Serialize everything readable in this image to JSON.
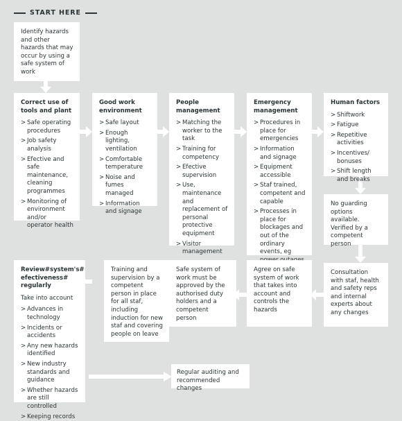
{
  "theme": {
    "background": "#dfe1e1",
    "box_fill": "#ffffff",
    "text": "#2b3436",
    "connector": "#ffffff"
  },
  "header": {
    "label": "START HERE"
  },
  "boxes": {
    "identify": {
      "title": "",
      "body": "Identify hazards and other hazards that may occur by using a safe system of work"
    },
    "tools": {
      "title": "Correct use of tools and plant",
      "items": [
        "Safe operating procedures",
        "Job safety analysis",
        "Efective and safe maintenance, cleaning programmes",
        "Monitoring of environment and/or operator health"
      ]
    },
    "environment": {
      "title": "Good work environment",
      "items": [
        "Safe layout",
        "Enough lighting, ventilation",
        "Comfortable temperature",
        "Noise and fumes managed",
        "Information and signage"
      ]
    },
    "people": {
      "title": "People management",
      "items": [
        "Matching the worker to the task",
        "Training for competency",
        "Efective supervision",
        "Use, maintenance and replacement of personal protective equipment",
        "Visitor management"
      ]
    },
    "emergency": {
      "title": "Emergency management",
      "items": [
        "Procedures in place for emergencies",
        "Information and signage",
        "Equipment accessible",
        "Staf trained, competent and capable",
        "Processes in place for blockages and out of the ordinary events, eg power outages"
      ]
    },
    "human": {
      "title": "Human factors",
      "items": [
        "Shiftwork",
        "Fatigue",
        "Repetitive activities",
        "Incentives/ bonuses",
        "Shift length and breaks"
      ]
    },
    "guarding": {
      "title": "",
      "body": "No guarding options available. Verified by a competent person"
    },
    "consultation": {
      "title": "",
      "body": "Consultation with staf, health and safety reps and internal experts about any changes"
    },
    "agree": {
      "title": "",
      "body": "Agree on safe system of work that takes into account and controls the hazards"
    },
    "approve": {
      "title": "",
      "body": "Safe system of work must be approved by the authorised duty holders and a competent person"
    },
    "training": {
      "title": "",
      "body": "Training and supervision by a competent person in place for all staf, including induction for new staf and covering people on leave"
    },
    "review": {
      "title": "Review#system's# efectiveness# regularly",
      "intro": "Take into account",
      "items": [
        "Advances in technology",
        "Incidents or accidents",
        "Any new hazards identified",
        "New industry standards and guidance",
        "Whether hazards are still controlled",
        "Keeping records"
      ]
    },
    "auditing": {
      "title": "",
      "body": "Regular auditing and recommended changes"
    }
  },
  "connectors": [
    {
      "name": "identify-to-tools",
      "direction": "down"
    },
    {
      "name": "tools-to-environment",
      "direction": "right"
    },
    {
      "name": "environment-to-people",
      "direction": "right"
    },
    {
      "name": "people-to-emergency",
      "direction": "right"
    },
    {
      "name": "emergency-to-human",
      "direction": "right"
    },
    {
      "name": "human-to-guarding",
      "direction": "down"
    },
    {
      "name": "guarding-to-consultation",
      "direction": "down"
    },
    {
      "name": "consultation-to-agree",
      "direction": "left"
    },
    {
      "name": "agree-to-approve",
      "direction": "left"
    },
    {
      "name": "approve-to-training",
      "direction": "left"
    },
    {
      "name": "training-to-review",
      "direction": "left"
    },
    {
      "name": "review-to-auditing",
      "direction": "right"
    }
  ]
}
